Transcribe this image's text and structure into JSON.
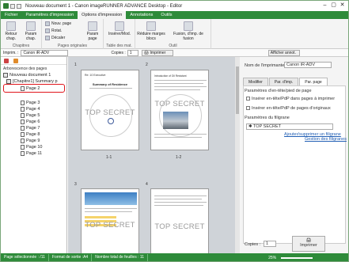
{
  "window": {
    "title": "Nouveau document 1 - Canon imageRUNNER ADVANCE Desktop - Editor"
  },
  "menu": [
    {
      "label": "Fichier"
    },
    {
      "label": "Paramètres d'impression"
    },
    {
      "label": "Options d'impression",
      "active": true
    },
    {
      "label": "Annotations"
    },
    {
      "label": "Outils"
    }
  ],
  "ribbon": {
    "retour_chap": "Retour chap.",
    "param_chap": "Param chap.",
    "chapitres": "Chapitres",
    "nouv_page": "Nouv. page",
    "rotat": "Rotat.",
    "decaler": "Décaler",
    "param_page": "Param page",
    "pages_originales": "Pages originales",
    "inserer_mod": "Insérer/Mod.",
    "table_des_mat": "Table des mat.",
    "reduire_marges": "Réduire marges blocs",
    "fusion": "Fusion, d'imp. de fusion",
    "outil": "Outil",
    "copies_label": "Copies :",
    "copies_value": "1",
    "imprimer": "Imprimer",
    "afficher_annot": "Afficher annot."
  },
  "printbar": {
    "label": "Imprim. :",
    "printer": "Canon iR-ADV"
  },
  "left": {
    "header": "Arborescence des pages",
    "doc": "Nouveau document 1",
    "chapter": "[Chapitre1] Summary p",
    "pages": [
      "Page 2",
      "Page 3",
      "Page 4",
      "Page 5",
      "Page 6",
      "Page 7",
      "Page 8",
      "Page 9",
      "Page 10",
      "Page 11"
    ]
  },
  "center": {
    "page_numbers": [
      "1",
      "2",
      "3",
      "4"
    ],
    "labels": [
      "1-1",
      "1-2"
    ],
    "watermark": "TOP SECRET",
    "p1_head": "Re: 10 Executive",
    "p1_title": "Summary of Residence",
    "p2_head": "Introduction of Oil Resistant"
  },
  "right": {
    "printer_label": "Nom de l'imprimante :",
    "printer_value": "Canon iR-ADV",
    "tabs": [
      "Modifier",
      "Par. d'imp.",
      "Par. page"
    ],
    "header_footer": "Paramètres d'en-tête/pied de page",
    "chk1": "Insérer en-tête/PdP dans pages à imprimer",
    "chk2": "Insérer en-tête/PdP de pages d'originaux",
    "watermark_params": "Paramètres du filigrane",
    "watermark_value": "TOP SECRET",
    "link1": "Ajouter/supprimer un filigrane",
    "link2": "Gestion des filigranes",
    "copies_label": "Copies :",
    "copies_value": "1",
    "imprimer": "Imprimer"
  },
  "status": {
    "page": "Page sélectionnée : /11",
    "format": "Format de sortie :A4",
    "sheets": "Nombre total de feuilles : 11",
    "zoom": "25%"
  }
}
